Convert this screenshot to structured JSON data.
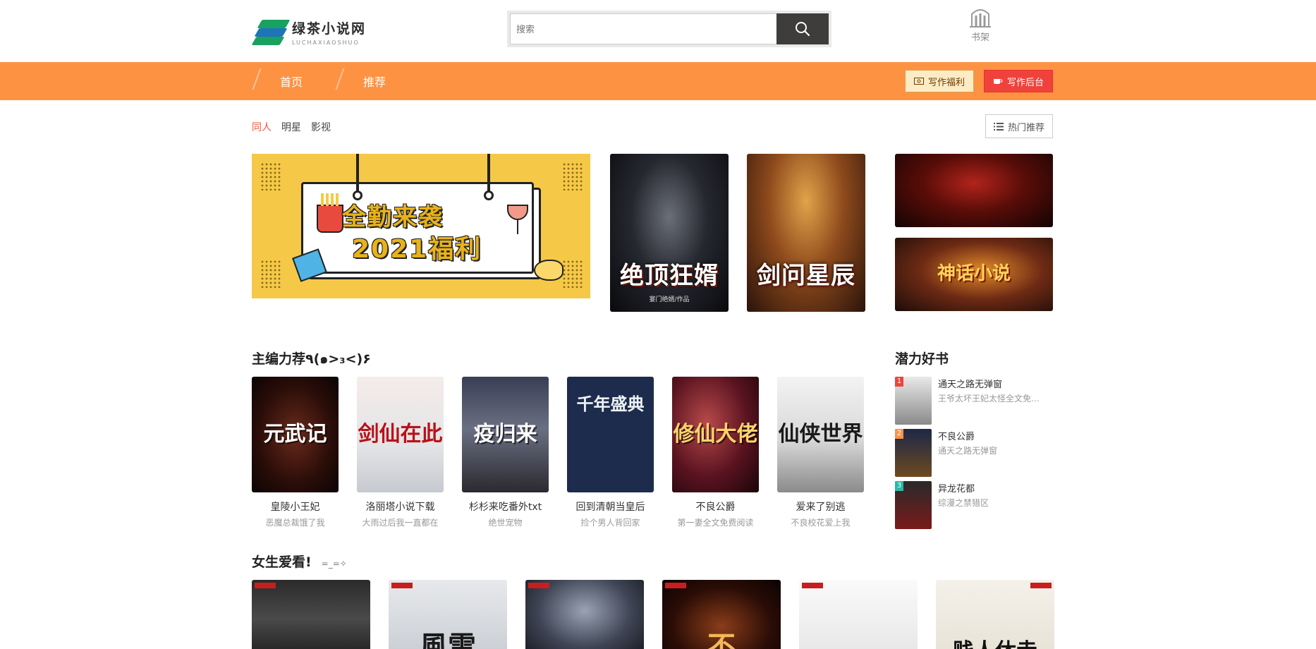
{
  "header": {
    "logo_cn": "绿茶小说网",
    "logo_en": "LUCHAXIAOSHUO",
    "search_placeholder": "搜索",
    "shelf_label": "书架"
  },
  "nav": {
    "items": [
      "首页",
      "推荐"
    ],
    "welfare_label": "写作福利",
    "backend_label": "写作后台",
    "accent": "#fe9243"
  },
  "categories": {
    "tabs": [
      "同人",
      "明星",
      "影视"
    ],
    "active": "同人",
    "hot_label": "热门推荐"
  },
  "banners": {
    "promo_line1": "全勤来袭",
    "promo_line2": "2021福利",
    "cover1_title": "绝顶狂婿",
    "cover1_sub": "宴门绝婿/作品",
    "cover2_title": "剑问星辰",
    "side2_title": "神话小说"
  },
  "editor": {
    "title": "主编力荐٩(๑>₃<)۶",
    "books": [
      {
        "cover": "元武记",
        "name": "皇陵小王妃",
        "desc": "恶魔总裁饿了我"
      },
      {
        "cover": "剑仙在此",
        "name": "洛丽塔小说下载",
        "desc": "大雨过后我一直都在"
      },
      {
        "cover": "疫归来",
        "name": "杉杉来吃番外txt",
        "desc": "绝世宠物"
      },
      {
        "cover": "千年盛典",
        "name": "回到清朝当皇后",
        "desc": "捡个男人背回家"
      },
      {
        "cover": "修仙大佬",
        "name": "不良公爵",
        "desc": "第一妻全文免费阅读"
      },
      {
        "cover": "仙侠世界",
        "name": "爱来了别逃",
        "desc": "不良校花爱上我"
      }
    ]
  },
  "potential": {
    "title": "潜力好书",
    "items": [
      {
        "rank": "1",
        "name": "通天之路无弹窗",
        "author": "王爷太坏王妃太怪全文免费阅读",
        "rank_color": "#f0423c"
      },
      {
        "rank": "2",
        "name": "不良公爵",
        "author": "通天之路无弹窗",
        "rank_color": "#fe9243"
      },
      {
        "rank": "3",
        "name": "异龙花都",
        "author": "综漫之禁猎区",
        "rank_color": "#2bb8a8"
      }
    ]
  },
  "girls": {
    "title": "女生爱看!",
    "subtitle": "=_=✧",
    "covers": [
      "",
      "風雷",
      "",
      "不",
      "",
      "贱人休走"
    ]
  }
}
